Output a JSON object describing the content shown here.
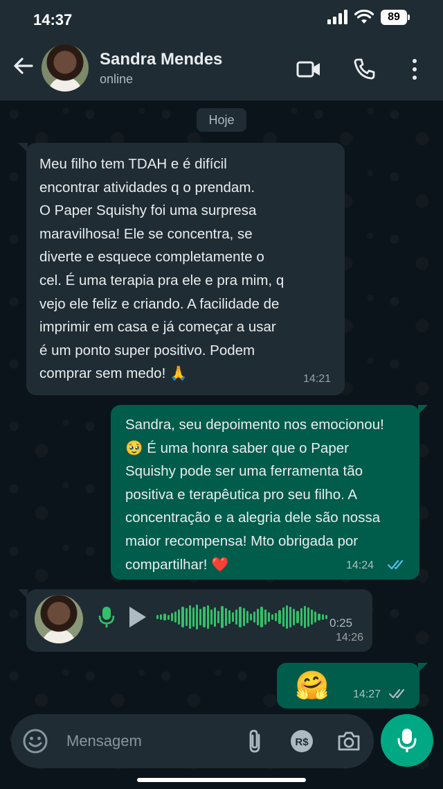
{
  "status_bar": {
    "time": "14:37",
    "battery": "89"
  },
  "header": {
    "contact_name": "Sandra Mendes",
    "contact_status": "online"
  },
  "date_chip": "Hoje",
  "messages": [
    {
      "direction": "incoming",
      "lines": [
        "Meu filho tem TDAH e é difícil",
        "encontrar atividades q o prendam.",
        "O Paper Squishy foi uma surpresa",
        "maravilhosa! Ele se concentra, se",
        "diverte e esquece completamente o",
        "cel. É uma terapia pra ele e pra mim, q",
        "vejo ele feliz e criando. A facilidade de",
        "imprimir em casa e já começar a usar",
        "é um ponto super positivo. Podem",
        "comprar sem medo! 🙏"
      ],
      "time": "14:21"
    },
    {
      "direction": "outgoing",
      "lines": [
        "Sandra, seu depoimento nos emocionou!",
        "🥹 É uma honra saber que o Paper",
        "Squishy pode ser uma ferramenta tão",
        "positiva e terapêutica pro seu filho. A",
        "concentração e a alegria dele são nossa",
        "maior recompensa! Mto obrigada por",
        "compartilhar! ❤️"
      ],
      "time": "14:24",
      "read": true
    },
    {
      "direction": "incoming",
      "type": "audio",
      "duration": "0:25",
      "time": "14:26"
    },
    {
      "direction": "outgoing",
      "type": "emoji",
      "emoji": "🤗",
      "time": "14:27",
      "read": false
    }
  ],
  "composer": {
    "placeholder": "Mensagem"
  },
  "colors": {
    "incoming_bubble": "#1f2c34",
    "outgoing_bubble": "#005c4b",
    "accent": "#00a884",
    "read_ticks": "#53bdeb",
    "waveform": "#33c06a"
  },
  "icons": [
    "back-arrow-icon",
    "video-call-icon",
    "phone-icon",
    "more-vert-icon",
    "mic-icon",
    "play-icon",
    "emoji-icon",
    "attach-icon",
    "payment-icon",
    "camera-icon"
  ]
}
